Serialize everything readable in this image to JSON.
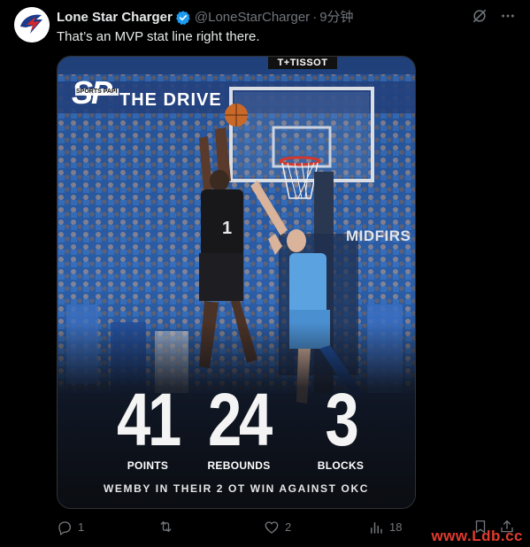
{
  "tweet": {
    "display_name": "Lone Star Charger",
    "handle": "@LoneStarCharger",
    "separator": "·",
    "time": "9分钟",
    "text": "That’s an MVP stat line right there."
  },
  "media": {
    "sponsor_text": "T+TISSOT",
    "logo_big": "SP",
    "logo_small": "SPORTS PAPI",
    "banner_text": "THE DRIVE",
    "arena_sign": "MIDFIRS",
    "stats": [
      {
        "value": "41",
        "label": "POINTS"
      },
      {
        "value": "24",
        "label": "REBOUNDS"
      },
      {
        "value": "3",
        "label": "BLOCKS"
      }
    ],
    "caption": "WEMBY IN THEIR 2 OT WIN AGAINST OKC"
  },
  "actions": {
    "reply_count": "1",
    "retweet_count": "",
    "like_count": "2",
    "views_count": "18"
  },
  "watermark": "www.Ldb.cc",
  "colors": {
    "background": "#000000",
    "text_primary": "#e7e9ea",
    "text_secondary": "#71767b",
    "verified": "#1d9bf0",
    "watermark": "#e23b2e"
  },
  "icons": {
    "verified": "verified-badge-icon",
    "grok": "grok-icon",
    "more": "more-icon",
    "reply": "reply-icon",
    "retweet": "retweet-icon",
    "like": "like-icon",
    "views": "views-icon",
    "bookmark": "bookmark-icon",
    "share": "share-icon"
  }
}
